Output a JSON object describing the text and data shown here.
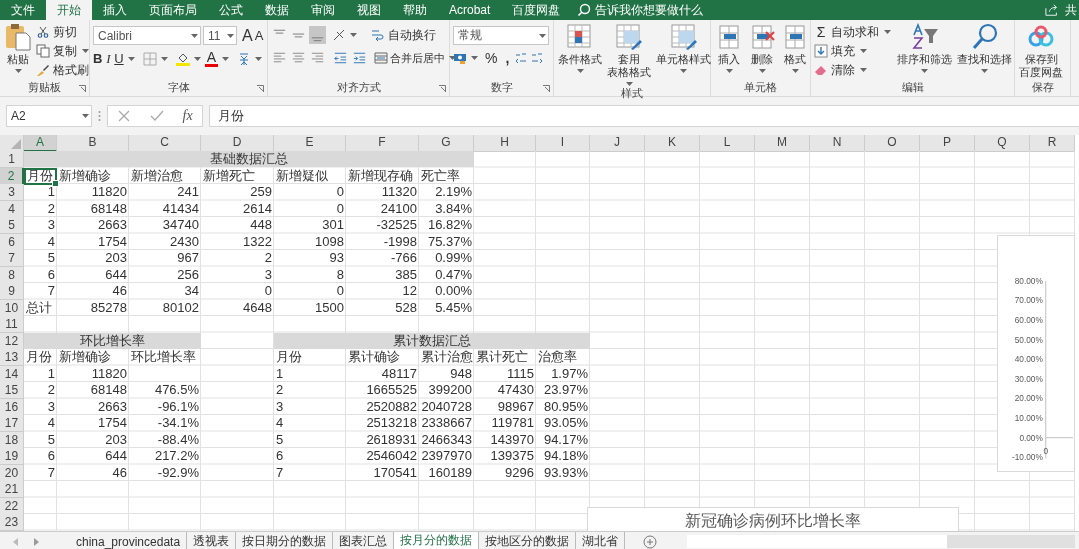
{
  "menu_tabs": [
    {
      "label": "文件",
      "selected": false
    },
    {
      "label": "开始",
      "selected": true
    },
    {
      "label": "插入",
      "selected": false
    },
    {
      "label": "页面布局",
      "selected": false
    },
    {
      "label": "公式",
      "selected": false
    },
    {
      "label": "数据",
      "selected": false
    },
    {
      "label": "审阅",
      "selected": false
    },
    {
      "label": "视图",
      "selected": false
    },
    {
      "label": "帮助",
      "selected": false
    },
    {
      "label": "Acrobat",
      "selected": false
    },
    {
      "label": "百度网盘",
      "selected": false
    }
  ],
  "tell_me": {
    "placeholder": "告诉我你想要做什么"
  },
  "share": "共",
  "ribbon": {
    "clipboard": {
      "label": "剪贴板",
      "paste": "粘贴",
      "cut": "剪切",
      "copy": "复制",
      "painter": "格式刷"
    },
    "font": {
      "label": "字体",
      "family": "Calibri",
      "size": "11",
      "grow": "A",
      "shrink": "A",
      "styles": [
        "B",
        "I",
        "U"
      ],
      "color_letter": "A"
    },
    "alignment": {
      "label": "对齐方式",
      "vertical": [
        {
          "selected": false
        },
        {
          "selected": false
        },
        {
          "selected": true
        }
      ],
      "wrap": "自动换行",
      "merge": "合并后居中"
    },
    "number": {
      "label": "数字",
      "format": "常规",
      "percent": "%",
      "comma": ","
    },
    "styles": {
      "label": "样式",
      "buttons": [
        {
          "lines": [
            "条件格式"
          ]
        },
        {
          "lines": [
            "套用",
            "表格格式"
          ]
        },
        {
          "lines": [
            "单元格样式"
          ]
        }
      ]
    },
    "cells": {
      "label": "单元格",
      "buttons": [
        "插入",
        "删除",
        "格式"
      ]
    },
    "editing": {
      "label": "编辑",
      "sum_symbol": "Σ",
      "sum": "自动求和",
      "fill": "填充",
      "clear": "清除",
      "sort": "排序和筛选",
      "find": "查找和选择"
    },
    "save": {
      "label": "保存",
      "lines": [
        "保存到",
        "百度网盘"
      ]
    }
  },
  "formula_bar": {
    "fx": "fx",
    "value": "月份"
  },
  "sheet": {
    "columns": [
      "A",
      "B",
      "C",
      "D",
      "E",
      "F",
      "G",
      "H",
      "I",
      "J",
      "K",
      "L",
      "M",
      "N",
      "O",
      "P",
      "Q",
      "R"
    ],
    "row_numbers": [
      "1",
      "2",
      "3",
      "4",
      "5",
      "6",
      "7",
      "8",
      "9",
      "10",
      "11",
      "12",
      "13",
      "14",
      "15",
      "16",
      "17",
      "18",
      "19",
      "20",
      "21",
      "22",
      "23"
    ],
    "active_cell": "A2",
    "basic_summary": {
      "title": "基础数据汇总",
      "first_column_left": false,
      "header": [
        "月份",
        "新增确诊",
        "新增治愈",
        "新增死亡",
        "新增疑似",
        "新增现存确",
        "死亡率"
      ],
      "rows": [
        [
          "1",
          "11820",
          "241",
          "259",
          "0",
          "11320",
          "2.19%"
        ],
        [
          "2",
          "68148",
          "41434",
          "2614",
          "0",
          "24100",
          "3.84%"
        ],
        [
          "3",
          "2663",
          "34740",
          "448",
          "301",
          "-32525",
          "16.82%"
        ],
        [
          "4",
          "1754",
          "2430",
          "1322",
          "1098",
          "-1998",
          "75.37%"
        ],
        [
          "5",
          "203",
          "967",
          "2",
          "93",
          "-766",
          "0.99%"
        ],
        [
          "6",
          "644",
          "256",
          "3",
          "8",
          "385",
          "0.47%"
        ],
        [
          "7",
          "46",
          "34",
          "0",
          "0",
          "12",
          "0.00%"
        ]
      ],
      "total": {
        "label": "总计",
        "values": [
          "85278",
          "80102",
          "4648",
          "1500",
          "528",
          "5.45%"
        ]
      }
    },
    "growth": {
      "title": "环比增长率",
      "first_column_left": false,
      "header": [
        "月份",
        "新增确诊",
        "环比增长率"
      ],
      "rows": [
        [
          "1",
          "11820"
        ],
        [
          "2",
          "68148",
          "476.5%"
        ],
        [
          "3",
          "2663",
          "-96.1%"
        ],
        [
          "4",
          "1754",
          "-34.1%"
        ],
        [
          "5",
          "203",
          "-88.4%"
        ],
        [
          "6",
          "644",
          "217.2%"
        ],
        [
          "7",
          "46",
          "-92.9%"
        ]
      ]
    },
    "cumulative": {
      "title": "累计数据汇总",
      "first_column_left": true,
      "header": [
        "月份",
        "累计确诊",
        "累计治愈",
        "累计死亡",
        "治愈率"
      ],
      "rows": [
        [
          "1",
          "48117",
          "948",
          "1115",
          "1.97%"
        ],
        [
          "2",
          "1665525",
          "399200",
          "47430",
          "23.97%"
        ],
        [
          "3",
          "2520882",
          "2040728",
          "98967",
          "80.95%"
        ],
        [
          "4",
          "2513218",
          "2338667",
          "119781",
          "93.05%"
        ],
        [
          "5",
          "2618931",
          "2466343",
          "143970",
          "94.17%"
        ],
        [
          "6",
          "2546042",
          "2397970",
          "139375",
          "94.18%"
        ],
        [
          "7",
          "170541",
          "160189",
          "9296",
          "93.93%"
        ]
      ]
    }
  },
  "side_chart": {
    "chart_data": {
      "type": "line",
      "categories": [
        "0"
      ],
      "ylim": [
        -0.1,
        0.8
      ],
      "yticks": [
        {
          "value": 0.8,
          "label": "80.00%"
        },
        {
          "value": 0.7,
          "label": "70.00%"
        },
        {
          "value": 0.6,
          "label": "60.00%"
        },
        {
          "value": 0.5,
          "label": "50.00%"
        },
        {
          "value": 0.4,
          "label": "40.00%"
        },
        {
          "value": 0.3,
          "label": "30.00%"
        },
        {
          "value": 0.2,
          "label": "20.00%"
        },
        {
          "value": 0.1,
          "label": "10.00%"
        },
        {
          "value": 0,
          "label": "0.00%"
        },
        {
          "value": -0.1,
          "label": "-10.00%"
        }
      ]
    }
  },
  "bottom_chart": {
    "title": "新冠确诊病例环比增长率"
  },
  "sheet_tabs": [
    {
      "label": "china_provincedata",
      "selected": false
    },
    {
      "label": "透视表",
      "selected": false
    },
    {
      "label": "按日期分的数据",
      "selected": false
    },
    {
      "label": "图表汇总",
      "selected": false
    },
    {
      "label": "按月分的数据",
      "selected": true
    },
    {
      "label": "按地区分的数据",
      "selected": false
    },
    {
      "label": "湖北省",
      "selected": false
    }
  ]
}
